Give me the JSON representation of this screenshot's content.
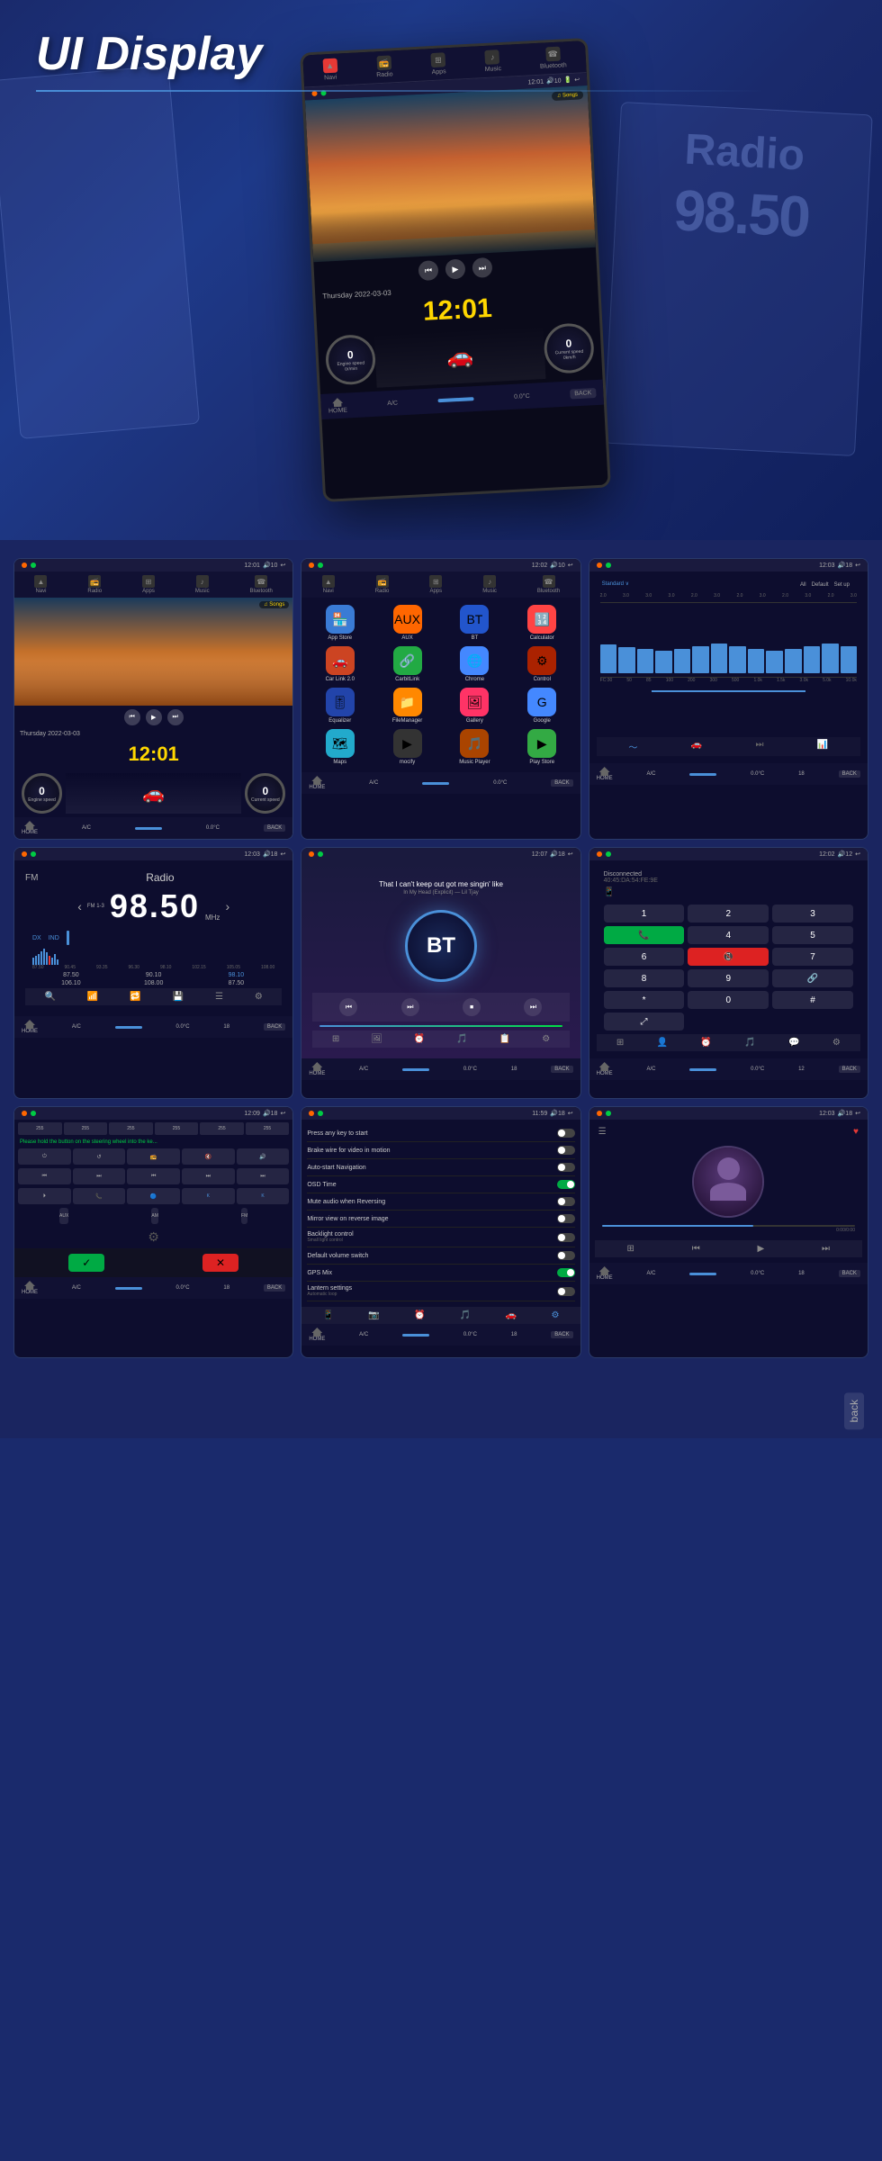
{
  "hero": {
    "title": "UI Display",
    "radio_bg_text": "Radio",
    "radio_freq_bg": "98.50"
  },
  "screens": {
    "row1": [
      {
        "id": "home",
        "status": {
          "time": "12:01",
          "signal": "10"
        },
        "nav": [
          "Navi",
          "Radio",
          "Apps",
          "Music",
          "Bluetooth"
        ],
        "music_label": "♫ Songs",
        "date": "Thursday 2022-03-03",
        "clock": "12:01",
        "speedo1_label": "Engine speed\n0r/min",
        "speedo2_label": "Current speed\n0km/h",
        "bottom": {
          "home": "HOME",
          "ac": "A/C 0.0°C",
          "back": "BACK"
        }
      },
      {
        "id": "apps",
        "status": {
          "time": "12:02",
          "signal": "10"
        },
        "nav": [
          "Navi",
          "Radio",
          "Apps",
          "Music",
          "Bluetooth"
        ],
        "apps": [
          {
            "name": "App Store",
            "color": "#3a7bd5",
            "icon": "🏪"
          },
          {
            "name": "AUX",
            "color": "#ff6600",
            "icon": "🔌"
          },
          {
            "name": "BT",
            "color": "#2255cc",
            "icon": "🔵"
          },
          {
            "name": "Calculator",
            "color": "#ff4444",
            "icon": "🔢"
          },
          {
            "name": "Car Link 2.0",
            "color": "#cc4422",
            "icon": "🚗"
          },
          {
            "name": "CarbitLink",
            "color": "#22aa44",
            "icon": "🔗"
          },
          {
            "name": "Chrome",
            "color": "#4488ff",
            "icon": "🌐"
          },
          {
            "name": "Control",
            "color": "#aa2200",
            "icon": "⚙"
          },
          {
            "name": "Equalizer",
            "color": "#2244aa",
            "icon": "🎚"
          },
          {
            "name": "FileManager",
            "color": "#ff8800",
            "icon": "📁"
          },
          {
            "name": "Gallery",
            "color": "#ff3366",
            "icon": "🖼"
          },
          {
            "name": "Google",
            "color": "#4488ff",
            "icon": "G"
          },
          {
            "name": "Maps",
            "color": "#22aacc",
            "icon": "🗺"
          },
          {
            "name": "mocify",
            "color": "#333",
            "icon": "▶"
          },
          {
            "name": "Music Player",
            "color": "#aa4400",
            "icon": "🎵"
          },
          {
            "name": "Play Store",
            "color": "#33aa44",
            "icon": "▶"
          }
        ]
      },
      {
        "id": "equalizer",
        "status": {
          "time": "12:03",
          "signal": "18"
        },
        "label_standard": "Standard",
        "label_all": "All",
        "label_default": "Default",
        "label_setup": "Set up",
        "db_labels": [
          "2.0",
          "3.0",
          "3.0",
          "3.0",
          "2.0",
          "3.0",
          "2.0",
          "3.0",
          "2.0",
          "3.0",
          "2.0",
          "3.0"
        ],
        "freq_labels": [
          "FC: 30",
          "50",
          "85",
          "100",
          "200",
          "300",
          "500",
          "1.0k",
          "1.5k",
          "3.0k",
          "3.0k",
          "5.0k",
          "10.0k",
          "12.0k"
        ],
        "bars": [
          60,
          55,
          50,
          45,
          50,
          55,
          60,
          55,
          50,
          45,
          50,
          55,
          60,
          55
        ]
      }
    ],
    "row2": [
      {
        "id": "radio",
        "status": {
          "time": "12:03",
          "signal": "18"
        },
        "fm_label": "FM",
        "radio_label": "Radio",
        "band_label": "FM 1-3",
        "freq": "98.50",
        "unit": "MHz",
        "dx": "DX",
        "ind": "IND",
        "signal_bars": [
          20,
          25,
          30,
          35,
          28,
          22,
          18,
          40,
          55,
          60,
          45,
          35,
          28
        ],
        "freq_presets": [
          "87.50",
          "90.10",
          "98.10",
          "106.10",
          "108.00",
          "87.50"
        ],
        "range": "87.50  90.45  93.35  96.30  98.10  102.15  105.05  108.00"
      },
      {
        "id": "bluetooth",
        "status": {
          "time": "12:07",
          "signal": "18"
        },
        "song_title": "That I can't keep out got me singin' like",
        "song_sub": "In My Head (Explicit) — Lil Tjay",
        "bt_label": "BT",
        "controls": [
          "⏮",
          "⏭",
          "⏹",
          "⏭"
        ]
      },
      {
        "id": "phone",
        "status": {
          "time": "12:02",
          "signal": "12"
        },
        "disconnect_label": "Disconnected",
        "bt_address": "40:45:DA:54:FE:9E",
        "keys": [
          "1",
          "2",
          "3",
          "4",
          "5",
          "6",
          "7",
          "8",
          "9",
          "*",
          "0",
          "#"
        ],
        "call_icon": "📞",
        "end_icon": "📵"
      }
    ],
    "row3": [
      {
        "id": "steering",
        "status": {
          "time": "12:09",
          "signal": "18"
        },
        "warning_text": "Please hold the button on the steering wheel into the ke...",
        "buttons_row1": [
          "255",
          "255",
          "255",
          "255",
          "255",
          "255"
        ],
        "buttons_row2": [
          "⏻",
          "↺",
          "📻",
          "🔇",
          "🔊"
        ],
        "buttons_row3": [
          "⏮",
          "⏭",
          "⏮",
          "⏭",
          "⏭"
        ],
        "buttons_row4": [
          "⏵",
          "📞",
          "🔵",
          "K",
          "K"
        ],
        "aux_label": "AUX",
        "am_label": "AM",
        "fm_label": "FM",
        "confirm_yes": "✓",
        "confirm_no": "✕"
      },
      {
        "id": "settings",
        "status": {
          "time": "11:59",
          "signal": "18"
        },
        "settings": [
          {
            "label": "Press any key to start",
            "toggle": false
          },
          {
            "label": "Brake wire for video in motion",
            "toggle": false
          },
          {
            "label": "Auto-start Navigation",
            "toggle": false
          },
          {
            "label": "OSD Time",
            "toggle": true
          },
          {
            "label": "Mute audio when Reversing",
            "toggle": false
          },
          {
            "label": "Mirror view on reverse image",
            "toggle": false
          },
          {
            "label": "Backlight control",
            "sub": "Small light control",
            "toggle": false
          },
          {
            "label": "Default volume switch",
            "toggle": false
          },
          {
            "label": "GPS Mix",
            "toggle": true
          },
          {
            "label": "Lantern settings",
            "sub": "Automatic loop",
            "toggle": false
          }
        ],
        "bottom_icons": [
          "📱",
          "📷",
          "⏰",
          "🎵",
          "📋",
          "⚙"
        ]
      },
      {
        "id": "music",
        "status": {
          "time": "12:03",
          "signal": "18"
        },
        "album_art": "🎵",
        "volume_bar": 60,
        "heart_icon": "♥",
        "menu_icon": "☰"
      }
    ]
  },
  "footer": {
    "back_label": "back"
  }
}
